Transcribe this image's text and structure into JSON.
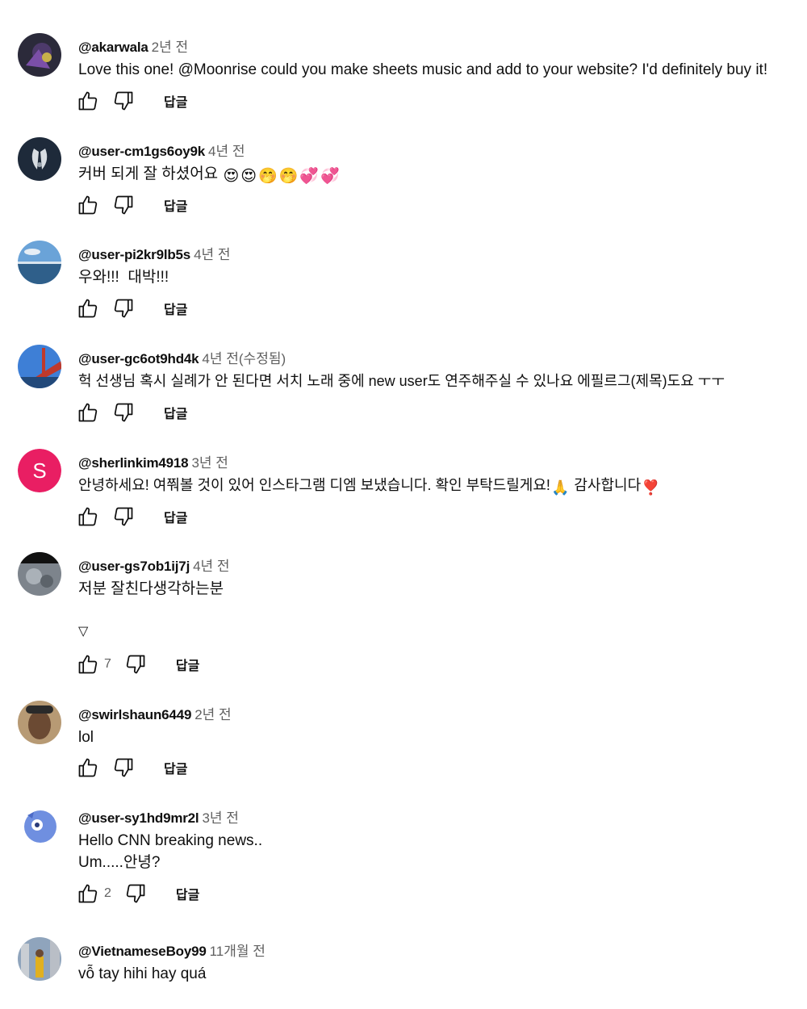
{
  "actions": {
    "reply_label": "답글"
  },
  "comments": [
    {
      "author": "@akarwala",
      "time": "2년 전",
      "text": "Love this one! @Moonrise could you make sheets music and add to your website? I'd definitely buy it!"
    },
    {
      "author": "@user-cm1gs6oy9k",
      "time": "4년 전",
      "text": "커버 되게 잘 하셨어요",
      "emojis": [
        "😍",
        "😍",
        "🤭",
        "🤭",
        "💞",
        "💞"
      ]
    },
    {
      "author": "@user-pi2kr9lb5s",
      "time": "4년 전",
      "text": "우와!!!  대박!!!"
    },
    {
      "author": "@user-gc6ot9hd4k",
      "time": "4년 전",
      "edited": "(수정됨)",
      "text": "헉 선생님 혹시 실례가 안 된다면 서치 노래 중에 new user도 연주해주실 수 있나요 에필르그(제목)도요 ㅜㅜ"
    },
    {
      "author": "@sherlinkim4918",
      "time": "3년 전",
      "avatar_letter": "S",
      "avatar_color": "#e91e63",
      "text_a": "안녕하세요! 여쭤볼 것이 있어 인스타그램 디엠 보냈습니다. 확인 부탁드릴게요!",
      "emoji_a": "🙏",
      "text_b": "감사합니다",
      "emoji_b": "❣️"
    },
    {
      "author": "@user-gs7ob1ij7j",
      "time": "4년 전",
      "text": "저분 잘친다생각하는분",
      "expand_icon": "▽",
      "like_count": "7"
    },
    {
      "author": "@swirlshaun6449",
      "time": "2년 전",
      "text": "lol"
    },
    {
      "author": "@user-sy1hd9mr2l",
      "time": "3년 전",
      "text": "Hello CNN breaking news..",
      "text_line2": "Um.....안녕?",
      "like_count": "2"
    },
    {
      "author": "@VietnameseBoy99",
      "time": "11개월 전",
      "text": "vỗ tay hihi hay quá"
    }
  ]
}
